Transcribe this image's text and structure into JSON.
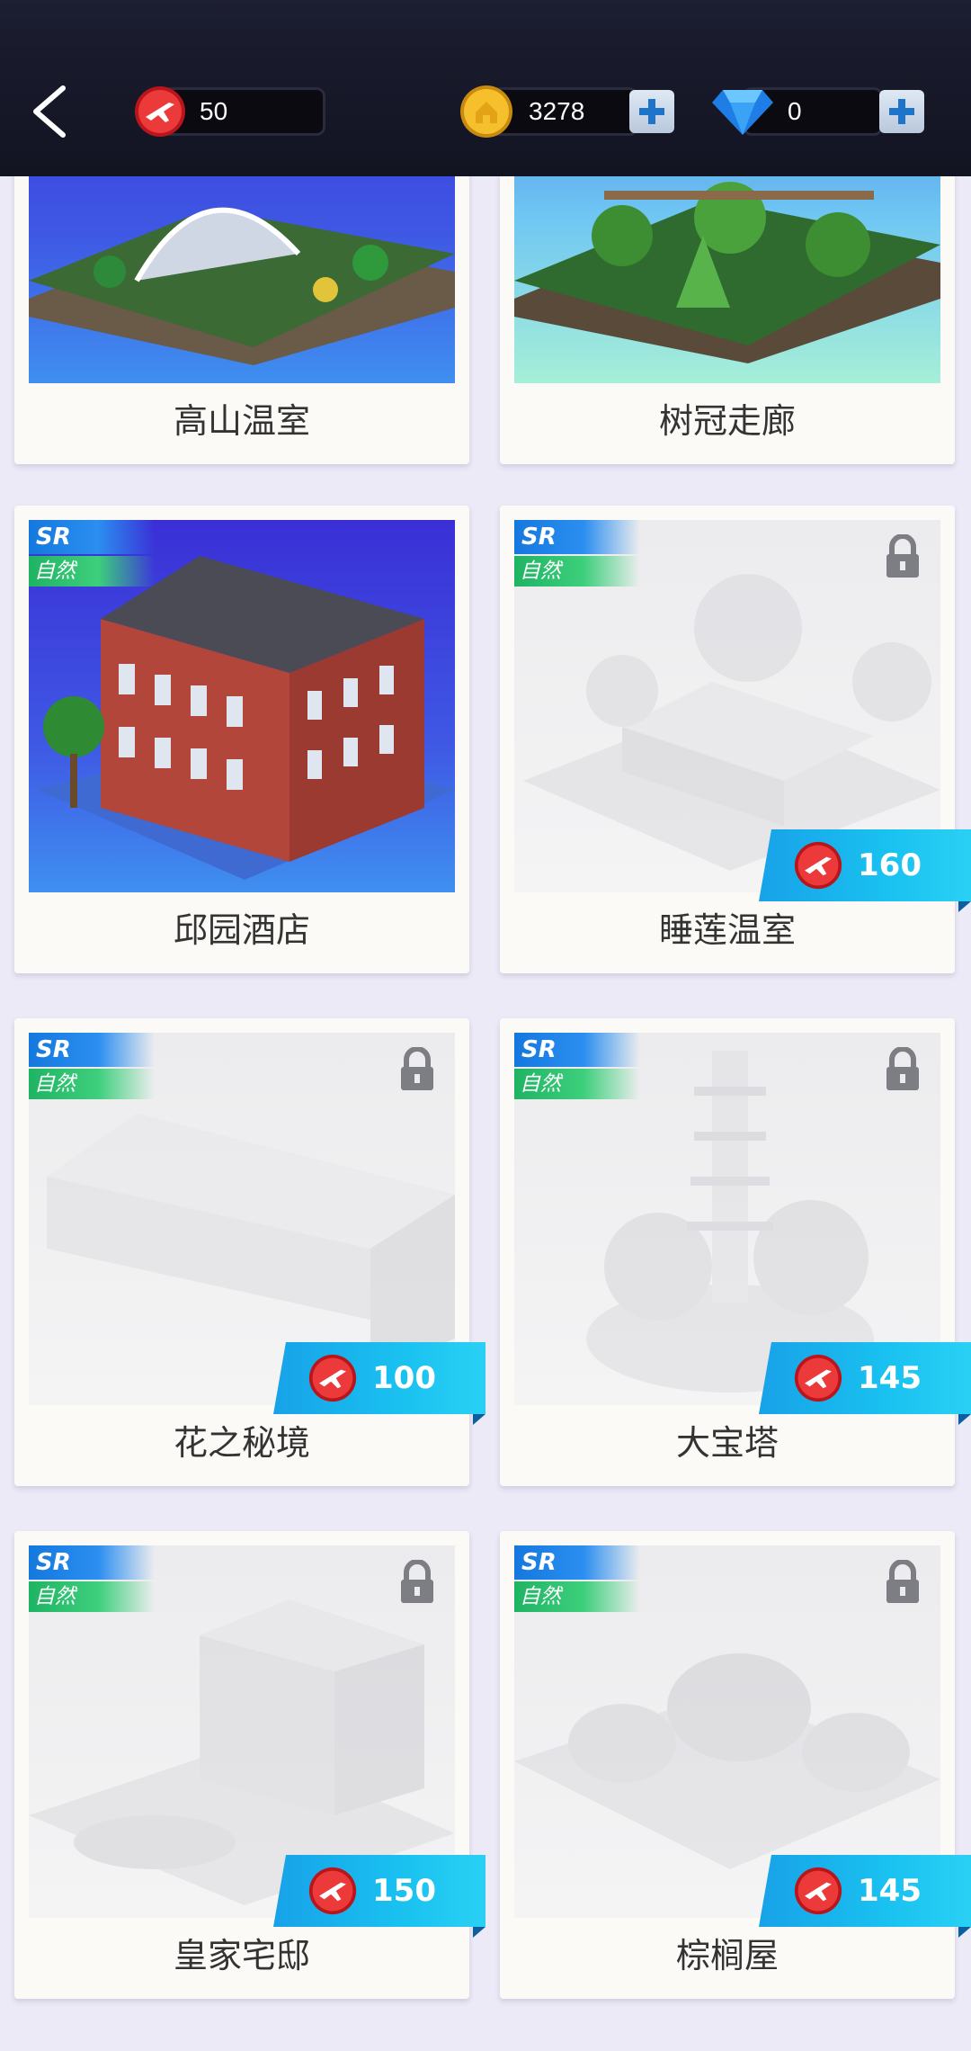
{
  "topbar": {
    "back_icon": "chevron-left-icon",
    "ticket": {
      "icon": "plane-ticket-icon",
      "value": "50"
    },
    "coins": {
      "icon": "gold-coin-icon",
      "value": "3278",
      "add_icon": "plus-icon"
    },
    "gems": {
      "icon": "diamond-icon",
      "value": "0",
      "add_icon": "plus-icon"
    }
  },
  "colors": {
    "accent": "#1ab8ef",
    "ticket_red": "#e8262c",
    "coin_gold": "#f0b420",
    "gem_blue": "#2f8ff0"
  },
  "cards": [
    {
      "name": "高山温室",
      "locked": false
    },
    {
      "name": "树冠走廊",
      "locked": false
    },
    {
      "name": "邱园酒店",
      "rarity": "SR",
      "category": "自然",
      "locked": false
    },
    {
      "name": "睡莲温室",
      "rarity": "SR",
      "category": "自然",
      "locked": true,
      "price": "160"
    },
    {
      "name": "花之秘境",
      "rarity": "SR",
      "category": "自然",
      "locked": true,
      "price": "100"
    },
    {
      "name": "大宝塔",
      "rarity": "SR",
      "category": "自然",
      "locked": true,
      "price": "145"
    },
    {
      "name": "皇家宅邸",
      "rarity": "SR",
      "category": "自然",
      "locked": true,
      "price": "150"
    },
    {
      "name": "棕榈屋",
      "rarity": "SR",
      "category": "自然",
      "locked": true,
      "price": "145"
    }
  ]
}
